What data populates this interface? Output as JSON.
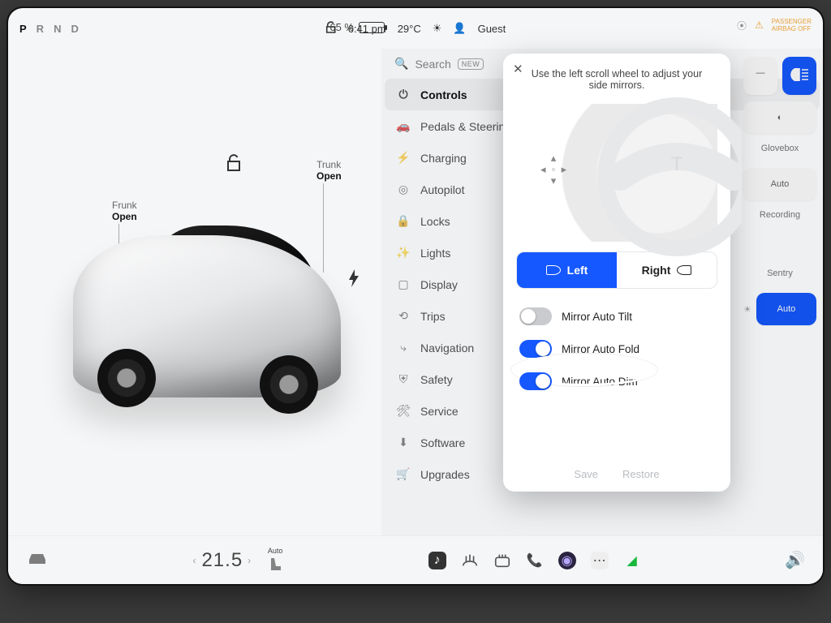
{
  "gear": {
    "p": "P",
    "r": "R",
    "n": "N",
    "d": "D",
    "current": "P"
  },
  "battery_pct": "65 %",
  "battery_fill_pct": 65,
  "time": "6:41 pm",
  "outside_temp": "29°C",
  "profile": "Guest",
  "airbag_line1": "PASSENGER",
  "airbag_line2": "AIRBAG OFF",
  "car": {
    "frunk_label": "Frunk",
    "frunk_state": "Open",
    "trunk_label": "Trunk",
    "trunk_state": "Open"
  },
  "search_placeholder": "Search",
  "search_badge": "NEW",
  "menu": {
    "controls": "Controls",
    "pedals": "Pedals & Steering",
    "charging": "Charging",
    "autopilot": "Autopilot",
    "locks": "Locks",
    "lights": "Lights",
    "display": "Display",
    "trips": "Trips",
    "navigation": "Navigation",
    "safety": "Safety",
    "service": "Service",
    "software": "Software",
    "upgrades": "Upgrades"
  },
  "quick": {
    "glovebox": "Glovebox",
    "auto": "Auto",
    "recording": "Recording",
    "sentry": "Sentry",
    "auto2": "Auto"
  },
  "popup": {
    "hint": "Use the left scroll wheel to adjust your side mirrors.",
    "left": "Left",
    "right": "Right",
    "tilt": "Mirror Auto Tilt",
    "fold": "Mirror Auto Fold",
    "dim": "Mirror Auto Dim",
    "save": "Save",
    "restore": "Restore",
    "tilt_on": false,
    "fold_on": true,
    "dim_on": true,
    "selected": "Left"
  },
  "climate": {
    "cabin_temp": "21.5",
    "seat_mode": "Auto"
  }
}
